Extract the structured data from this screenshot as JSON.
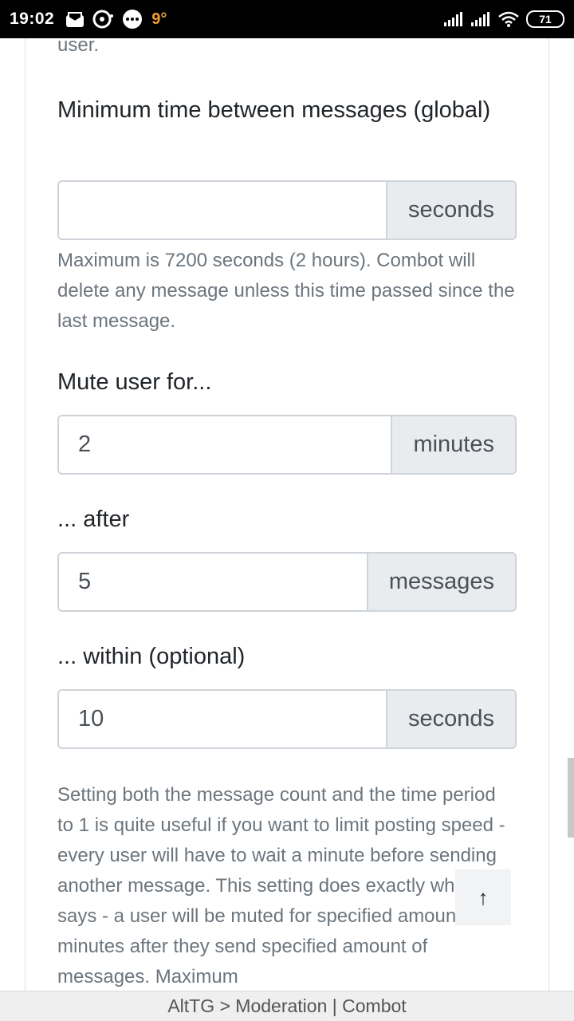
{
  "status_bar": {
    "time": "19:02",
    "temperature": "9°",
    "battery": "71",
    "icons": [
      "mail-icon",
      "chat-bubble-icon",
      "more-chat-icon",
      "signal-icon",
      "signal-icon",
      "wifi-icon",
      "battery-icon"
    ]
  },
  "top_fragment": "user.",
  "global_delay": {
    "label": "Minimum time between messages (global)",
    "value": "",
    "unit": "seconds",
    "help": "Maximum is 7200 seconds (2 hours). Combot will delete any message unless this time passed since the last message."
  },
  "mute": {
    "label": "Mute user for...",
    "value": "2",
    "unit": "minutes"
  },
  "after": {
    "label": "... after",
    "value": "5",
    "unit": "messages"
  },
  "within": {
    "label": "... within (optional)",
    "value": "10",
    "unit": "seconds"
  },
  "bottom_help": "Setting both the message count and the time period to 1 is quite useful if you want to limit posting speed - every user will have to wait a minute before sending another message. This setting does exactly what it says - a user will be muted for specified amount of minutes after they send specified amount of messages. Maximum",
  "scroll_top_label": "↑",
  "bottom_bar": "AltTG > Moderation | Combot"
}
